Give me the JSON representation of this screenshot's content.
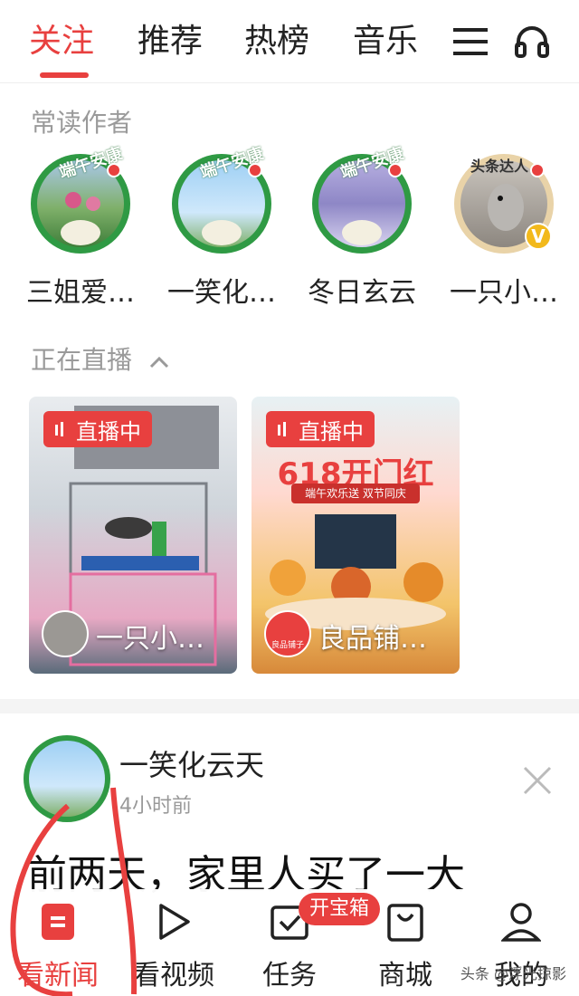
{
  "colors": {
    "accent": "#e8403f",
    "badge_green": "#2f9a44",
    "muted": "#999999"
  },
  "top_tabs": [
    {
      "label": "关注",
      "active": true
    },
    {
      "label": "推荐",
      "active": false
    },
    {
      "label": "热榜",
      "active": false
    },
    {
      "label": "音乐",
      "active": false
    }
  ],
  "top_icons": {
    "menu": "hamburger-icon",
    "audio": "headphones-icon"
  },
  "frequent_authors": {
    "title": "常读作者",
    "badge_text": "端午安康",
    "items": [
      {
        "name": "三姐爱…"
      },
      {
        "name": "一笑化…"
      },
      {
        "name": "冬日玄云"
      },
      {
        "name": "一只小…",
        "verified": "V",
        "badge_text": "头条达人"
      }
    ]
  },
  "live_section": {
    "title": "正在直播",
    "cards": [
      {
        "status": "直播中",
        "name": "一只小…"
      },
      {
        "status": "直播中",
        "name": "良品铺…",
        "poster_headline": "618开门红",
        "poster_sub": "端午欢乐送 双节同庆",
        "brand": "良品铺子"
      }
    ]
  },
  "post": {
    "author": "一笑化云天",
    "time": "4小时前",
    "text": "前两天，家里人买了一大"
  },
  "bottom_nav": {
    "items": [
      {
        "label": "看新闻",
        "active": true
      },
      {
        "label": "看视频",
        "active": false
      },
      {
        "label": "任务",
        "active": false
      },
      {
        "label": "商城",
        "active": false
      },
      {
        "label": "我的",
        "active": false
      }
    ],
    "task_badge": "开宝箱"
  },
  "watermark": "头条 @浮光掠影"
}
